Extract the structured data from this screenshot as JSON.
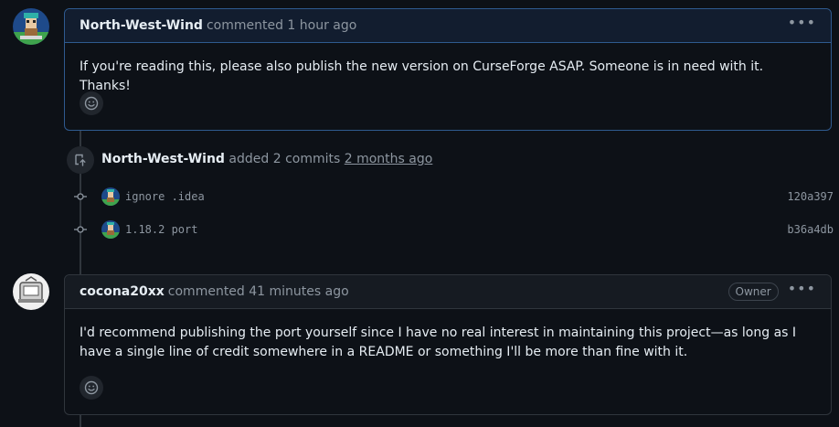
{
  "comments": [
    {
      "author": "North-West-Wind",
      "meta": "commented 1 hour ago",
      "body": "If you're reading this, please also publish the new version on CurseForge ASAP. Someone is in need with it. Thanks!",
      "badge": ""
    },
    {
      "author": "cocona20xx",
      "meta": "commented 41 minutes ago",
      "body": "I'd recommend publishing the port yourself since I have no real interest in maintaining this project—as long as I have a single line of credit somewhere in a README or something I'll be more than fine with it.",
      "badge": "Owner"
    }
  ],
  "event": {
    "author": "North-West-Wind",
    "verb": "added 2 commits",
    "time": "2 months ago"
  },
  "commits": [
    {
      "message": "ignore .idea",
      "sha": "120a397"
    },
    {
      "message": "1.18.2 port",
      "sha": "b36a4db"
    }
  ],
  "menu_glyph": "•••",
  "colors": {
    "background": "#0d1117",
    "border": "#30363d",
    "active_border": "#2f5a8f",
    "muted_text": "#8d96a0"
  },
  "icons": [
    "smiley-icon",
    "push-icon",
    "git-commit-icon",
    "kebab-menu-icon"
  ]
}
